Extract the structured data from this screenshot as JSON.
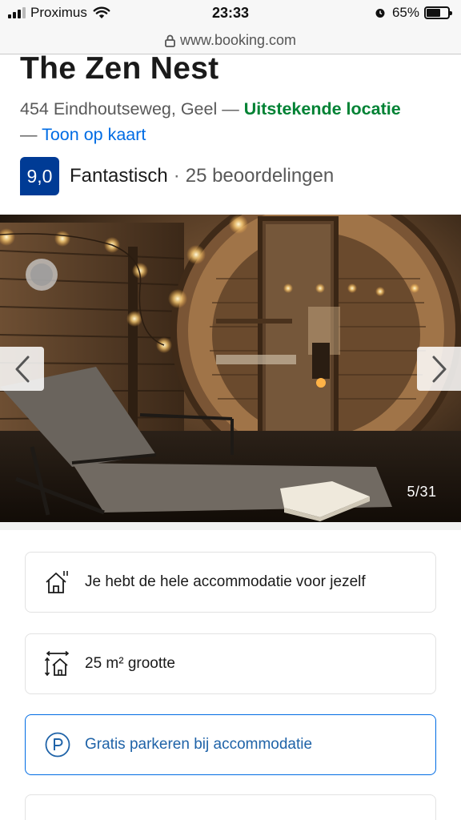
{
  "status_bar": {
    "carrier": "Proximus",
    "time": "23:33",
    "battery": "65%",
    "battery_level": 0.65,
    "icons": [
      "signal-icon",
      "wifi-icon",
      "alarm-icon",
      "battery-icon"
    ]
  },
  "browser": {
    "url": "www.booking.com",
    "icon": "lock-icon"
  },
  "property": {
    "name": "The Zen Nest",
    "address": "454 Eindhoutseweg, Geel",
    "separator": "—",
    "location_badge": "Uitstekende locatie",
    "map_link": "Toon op kaart"
  },
  "rating": {
    "score": "9,0",
    "label": "Fantastisch",
    "separator": "·",
    "count_text": "25 beoordelingen"
  },
  "gallery": {
    "counter": "5/31",
    "prev_icon": "chevron-left-icon",
    "next_icon": "chevron-right-icon"
  },
  "facilities": [
    {
      "icon": "house-icon",
      "label": "Je hebt de hele accommodatie voor jezelf"
    },
    {
      "icon": "size-icon",
      "label": "25 m² grootte"
    },
    {
      "icon": "parking-icon",
      "label": "Gratis parkeren bij accommodatie"
    },
    {
      "icon": "house-icon",
      "label": ""
    }
  ],
  "colors": {
    "brand_blue": "#003b95",
    "link_blue": "#006ce4",
    "success_green": "#008234"
  }
}
